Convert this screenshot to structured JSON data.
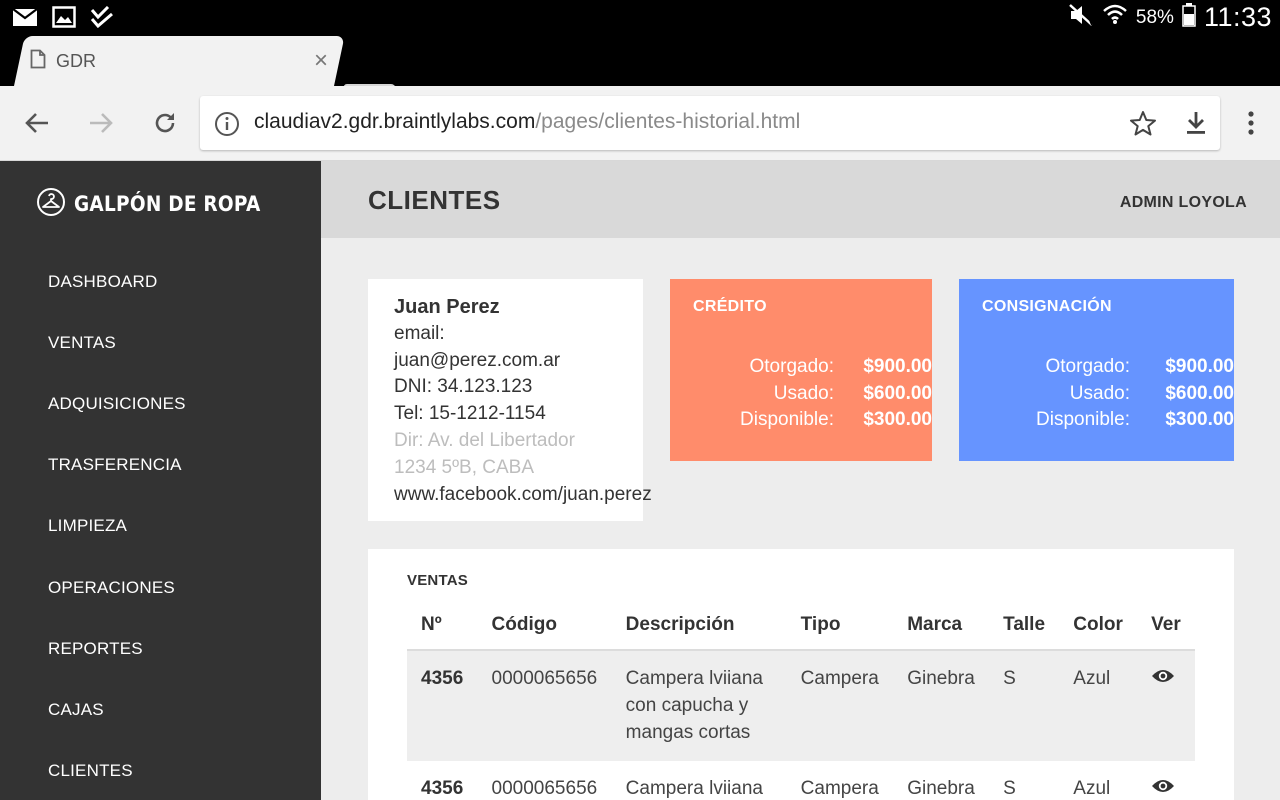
{
  "status_bar": {
    "battery_percent": "58%",
    "time": "11:33",
    "left_icons": [
      "mail-icon",
      "image-icon",
      "task-check-icon"
    ],
    "right_icons": [
      "mute-icon",
      "wifi-icon",
      "battery-icon"
    ]
  },
  "browser": {
    "tab_title": "GDR",
    "url_host": "claudiav2.gdr.braintlylabs.com",
    "url_path": "/pages/clientes-historial.html"
  },
  "sidebar": {
    "brand": "GALPÓN DE ROPA",
    "items": [
      {
        "label": "DASHBOARD"
      },
      {
        "label": "VENTAS"
      },
      {
        "label": "ADQUISICIONES"
      },
      {
        "label": "TRASFERENCIA"
      },
      {
        "label": "LIMPIEZA"
      },
      {
        "label": "OPERACIONES"
      },
      {
        "label": "REPORTES"
      },
      {
        "label": "CAJAS"
      },
      {
        "label": "CLIENTES"
      }
    ]
  },
  "header": {
    "title": "CLIENTES",
    "user": "ADMIN LOYOLA"
  },
  "client": {
    "name": "Juan Perez",
    "email_label": "email:",
    "email": "juan@perez.com.ar",
    "dni": "DNI: 34.123.123",
    "tel": "Tel: 15-1212-1154",
    "dir_line1": "Dir: Av. del Libertador",
    "dir_line2": "1234 5ºB, CABA",
    "facebook": "www.facebook.com/juan.perez"
  },
  "credito": {
    "title": "CRÉDITO",
    "color": "#ff8c6b",
    "otorgado_label": "Otorgado:",
    "otorgado": "$900.00",
    "usado_label": "Usado:",
    "usado": "$600.00",
    "disponible_label": "Disponible:",
    "disponible": "$300.00"
  },
  "consignacion": {
    "title": "CONSIGNACIÓN",
    "color": "#6694ff",
    "otorgado_label": "Otorgado:",
    "otorgado": "$900.00",
    "usado_label": "Usado:",
    "usado": "$600.00",
    "disponible_label": "Disponible:",
    "disponible": "$300.00"
  },
  "ventas": {
    "title": "VENTAS",
    "columns": [
      "Nº",
      "Código",
      "Descripción",
      "Tipo",
      "Marca",
      "Talle",
      "Color",
      "Ver"
    ],
    "rows": [
      {
        "numero": "4356",
        "codigo": "0000065656",
        "descripcion": "Campera lviiana con capucha y mangas cortas",
        "tipo": "Campera",
        "marca": "Ginebra",
        "talle": "S",
        "color": "Azul",
        "ver_icon": "eye-icon"
      },
      {
        "numero": "4356",
        "codigo": "0000065656",
        "descripcion": "Campera lviiana",
        "tipo": "Campera",
        "marca": "Ginebra",
        "talle": "S",
        "color": "Azul",
        "ver_icon": "eye-icon"
      }
    ]
  }
}
